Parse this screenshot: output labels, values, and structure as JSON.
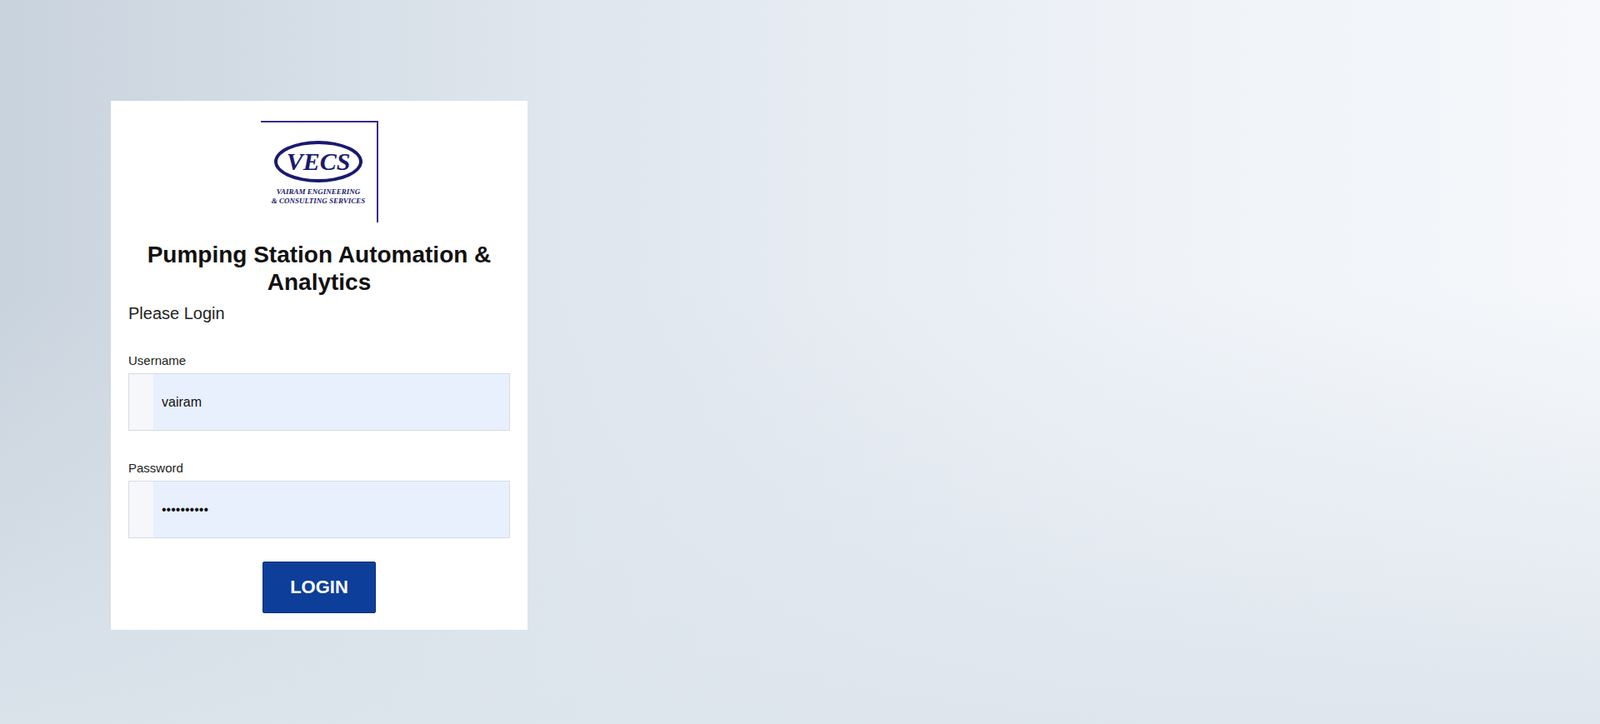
{
  "logo": {
    "mark": "VECS",
    "name_lines": [
      "VAIRAM ENGINEERING",
      "& CONSULTING SERVICES"
    ]
  },
  "title": "Pumping Station Automation & Analytics",
  "subtitle": "Please Login",
  "fields": [
    {
      "label": "Username",
      "value": "vairam"
    },
    {
      "label": "Password",
      "value": "••••••••••"
    }
  ],
  "buttons": [
    "LOGIN"
  ]
}
